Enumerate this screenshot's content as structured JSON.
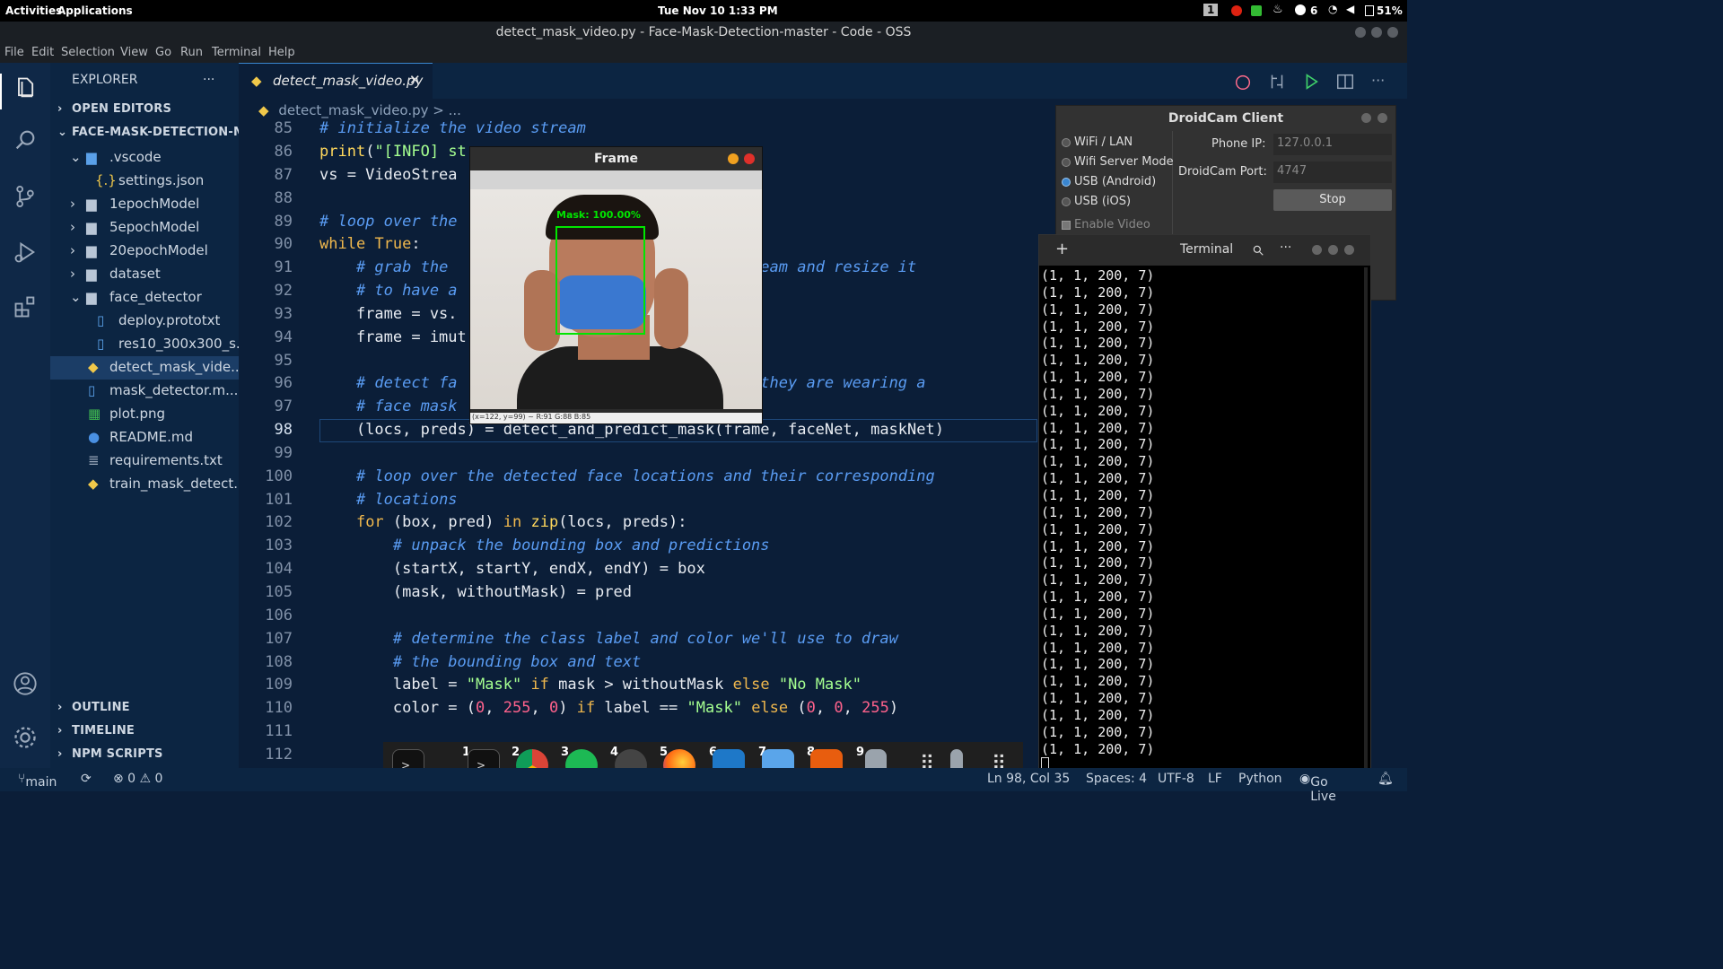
{
  "topbar": {
    "activities": "Activities",
    "applications": "Applications",
    "clock": "Tue Nov 10  1:33 PM",
    "workspace": "1",
    "notifications": "6",
    "battery": "51%"
  },
  "window": {
    "title": "detect_mask_video.py - Face-Mask-Detection-master - Code - OSS"
  },
  "menu": [
    "File",
    "Edit",
    "Selection",
    "View",
    "Go",
    "Run",
    "Terminal",
    "Help"
  ],
  "sidebar": {
    "title": "EXPLORER",
    "more": "···",
    "open_editors": "OPEN EDITORS",
    "project": "FACE-MASK-DETECTION-MA...",
    "items": [
      {
        "label": ".vscode"
      },
      {
        "label": "settings.json"
      },
      {
        "label": "1epochModel"
      },
      {
        "label": "5epochModel"
      },
      {
        "label": "20epochModel"
      },
      {
        "label": "dataset"
      },
      {
        "label": "face_detector"
      },
      {
        "label": "deploy.prototxt"
      },
      {
        "label": "res10_300x300_s..."
      },
      {
        "label": "detect_mask_vide..."
      },
      {
        "label": "mask_detector.m..."
      },
      {
        "label": "plot.png"
      },
      {
        "label": "README.md"
      },
      {
        "label": "requirements.txt"
      },
      {
        "label": "train_mask_detect..."
      }
    ],
    "outline": "OUTLINE",
    "timeline": "TIMELINE",
    "npm": "NPM SCRIPTS"
  },
  "editor": {
    "tab": "detect_mask_video.py",
    "breadcrumb": "detect_mask_video.py > ...",
    "line_numbers": [
      "85",
      "86",
      "87",
      "88",
      "89",
      "90",
      "91",
      "92",
      "93",
      "94",
      "95",
      "96",
      "97",
      "98",
      "99",
      "100",
      "101",
      "102",
      "103",
      "104",
      "105",
      "106",
      "107",
      "108",
      "109",
      "110",
      "111",
      "112"
    ]
  },
  "frame": {
    "title": "Frame",
    "label": "Mask: 100.00%",
    "coords": "(x=122, y=99) ~ R:91 G:88 B:85"
  },
  "droidcam": {
    "title": "DroidCam Client",
    "options": [
      "WiFi / LAN",
      "Wifi Server Mode",
      "USB (Android)",
      "USB (iOS)"
    ],
    "phone_ip_label": "Phone IP:",
    "phone_ip": "127.0.0.1",
    "port_label": "DroidCam Port:",
    "port": "4747",
    "stop": "Stop",
    "enable_video": "Enable Video"
  },
  "terminal": {
    "title": "Terminal",
    "plus": "+",
    "more": "···",
    "line": "(1, 1, 200, 7)"
  },
  "dock": {
    "numbers": [
      "1",
      "2",
      "3",
      "4",
      "5",
      "6",
      "7",
      "8",
      "9"
    ]
  },
  "statusbar": {
    "branch": "main",
    "problems": "⊗ 0 ⚠ 0",
    "position": "Ln 98, Col 35",
    "spaces": "Spaces: 4",
    "encoding": "UTF-8",
    "eol": "LF",
    "language": "Python",
    "golive": "Go Live"
  },
  "colors": {
    "editor_bg": "#0b1e38",
    "comment": "#5a9cf3",
    "keyword": "#f0b84d",
    "string": "#a5ff90",
    "number": "#ff628c",
    "mask_box": "#00e600"
  }
}
